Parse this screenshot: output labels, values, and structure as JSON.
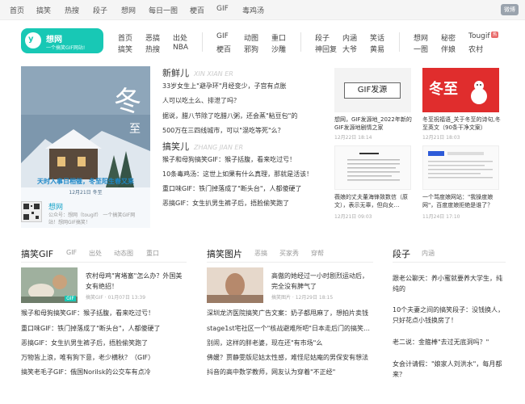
{
  "topbar": {
    "links": [
      "首页",
      "搞笑",
      "热搜",
      "段子",
      "想网",
      "每日一图",
      "梗百",
      "GIF",
      "毒鸡汤"
    ],
    "wechat": "微博"
  },
  "logo": {
    "glyph": "y",
    "name": "想网",
    "slogan": "一个搞笑GIF网站!"
  },
  "nav": {
    "col1": [
      "首页",
      "搞笑"
    ],
    "col2": [
      "恶搞",
      "热搜"
    ],
    "col3": [
      "出处",
      "NBA"
    ],
    "col4": [
      "GIF",
      "梗百"
    ],
    "col5": [
      "动图",
      "邪狗"
    ],
    "col6": [
      "重口",
      "沙雕"
    ],
    "col7": [
      "段子",
      "神回复"
    ],
    "col8": [
      "内涵",
      "大爷"
    ],
    "col9": [
      "笑话",
      "黄易"
    ],
    "col10": [
      "想网",
      "一图"
    ],
    "col11": [
      "秘密",
      "伴娘"
    ],
    "col12": [
      "Tougif",
      "农村"
    ],
    "hot_badge": "热"
  },
  "feature": {
    "poster_text1": "天时入事日相催，冬至阳生春又来",
    "poster_text2": "12月21日 冬至",
    "caption_name": "想网",
    "caption_line1": "公众号：想网（tougif） 一个搞笑GIF网",
    "caption_line2": "站！想网GIF搞笑！"
  },
  "fresh": {
    "title": "新鲜儿",
    "en": "XIN XIAN ER",
    "items": [
      "33岁女生上\"避孕环\"月经变少，子宫有点胀",
      "人可以吃土么、排泄了吗？",
      "据说，腊八节除了吃腊八粥，还会蒸\"粘豆包\"的",
      "500万在三四线城市，可以\"混吃等死\"么？"
    ]
  },
  "gaoxiao": {
    "title": "搞笑儿",
    "en": "ZHANG JIAN ER",
    "items": [
      "猴子和母狗搞笑GIF：猴子括腹，看来吃过亏！",
      "10条毒鸡汤：这世上如果有什么真理，那就是活该！",
      "重口味GIF：铁门掉落成了\"断头台\"，人都傻硬了",
      "恶搞GIF：女生扒男生裤子后，捂脸偷笑跑了"
    ]
  },
  "cards": [
    {
      "title": "想网，GIF发源地_2022年新的GIF发源地剧情之家",
      "date": "12月22日 18:14",
      "thumb_text": "GIF发源"
    },
    {
      "title": "冬至祝福语_关于冬至的诗句,冬至英文（90条干净文案）",
      "date": "12月21日 18:03",
      "thumb_text": "冬至"
    },
    {
      "title": "薇娘的丈夫董海锋致数信（原文），表示无辜，但向女…",
      "date": "12月21日 09:03",
      "thumb_text": ""
    },
    {
      "title": "一个骂度娘网站：\"我操度娘网\"，百度度娘拒绝是谁了？",
      "date": "11月24日 17:10",
      "thumb_text": ""
    }
  ],
  "gif_section": {
    "title": "搞笑GIF",
    "tabs": [
      "GIF",
      "出处",
      "动态图",
      "重口"
    ],
    "top_title": "农村母鸡\"宵堵塞\"怎么办？外国美女有绝招！",
    "top_meta": "搞笑GIF · 01月07日 13:39",
    "items": [
      "猴子和母狗搞笑GIF：猴子括腹，看来吃过亏！",
      "重口味GIF：铁门掉落成了\"断头台\"，人都傻硬了",
      "恶搞GIF：女生扒男生裤子后，捂脸偷笑跑了",
      "万物皆上浪，唯有狗下意，老少横秋？（GIF）",
      "搞笑老毛子GIF：俄国Norilsk的公交车有点冷"
    ]
  },
  "pic_section": {
    "title": "搞笑图片",
    "tabs": [
      "恶搞",
      "买家秀",
      "穿帮"
    ],
    "top_title": "高傲的她经过一小时剧烈运动后，完全没有脾气了",
    "top_meta": "搞笑图片 · 12月29日 18:15",
    "items": [
      "深圳龙济医院搞笑广告文案：奶子都甩麻了，想拍片卖钱",
      "stage1st宅社区一个\"核战避难所吧\"日本走后门的搞笑…",
      "别闹，这样的胖老婆，现在还\"有市场\"么",
      "佛媛？贾静雯版尼姑太性感，难怪尼姑庵的男保安有想法",
      "抖音的高中数学教师，网友认为穿着\"不正经\""
    ]
  },
  "joke_section": {
    "title": "段子",
    "tabs": [
      "内涵"
    ],
    "items": [
      "跟老公聊天：养小蜜就要养大学生，纯纯的",
      "10个夫妻之间的搞笑段子：没钱换人，只好花点小钱换房了！",
      "老二说：金箍棒\"去过无底洞吗？\"",
      "女会计请假：\"娘家人刘洪水\"，每月都来？"
    ]
  }
}
